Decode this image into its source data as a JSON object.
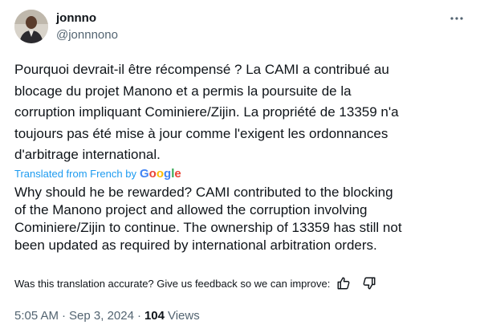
{
  "user": {
    "display_name": "jonnno",
    "handle": "@jonnnono",
    "avatar_icon": "profile-photo"
  },
  "more_icon": "more-horizontal-icon",
  "tweet": {
    "text": "Pourquoi devrait-il être récompensé ? La CAMI a contribué au\nblocage du projet Manono et a permis la poursuite de la\ncorruption impliquant Cominiere/Zijin. La propriété de 13359 n'a\ntoujours pas été mise à jour comme l'exigent les ordonnances\nd'arbitrage international.",
    "translated_from": "Translated from French by",
    "translator_logo": "Google",
    "translation": "Why should he be rewarded? CAMI contributed to the blocking\nof the Manono project and allowed the corruption involving\nCominiere/Zijin to continue. The ownership of 13359 has still not\nbeen updated as required by international arbitration orders."
  },
  "feedback": {
    "prompt": "Was this translation accurate? Give us feedback so we can improve:",
    "thumbs_up_icon": "thumbs-up-icon",
    "thumbs_down_icon": "thumbs-down-icon"
  },
  "meta": {
    "time": "5:05 AM",
    "date": "Sep 3, 2024",
    "views_count": "104",
    "views_label": "Views",
    "separator": "·"
  },
  "colors": {
    "link_blue": "#1d9bf0",
    "secondary_text": "#536471",
    "primary_text": "#0f1419",
    "background": "#ffffff"
  }
}
